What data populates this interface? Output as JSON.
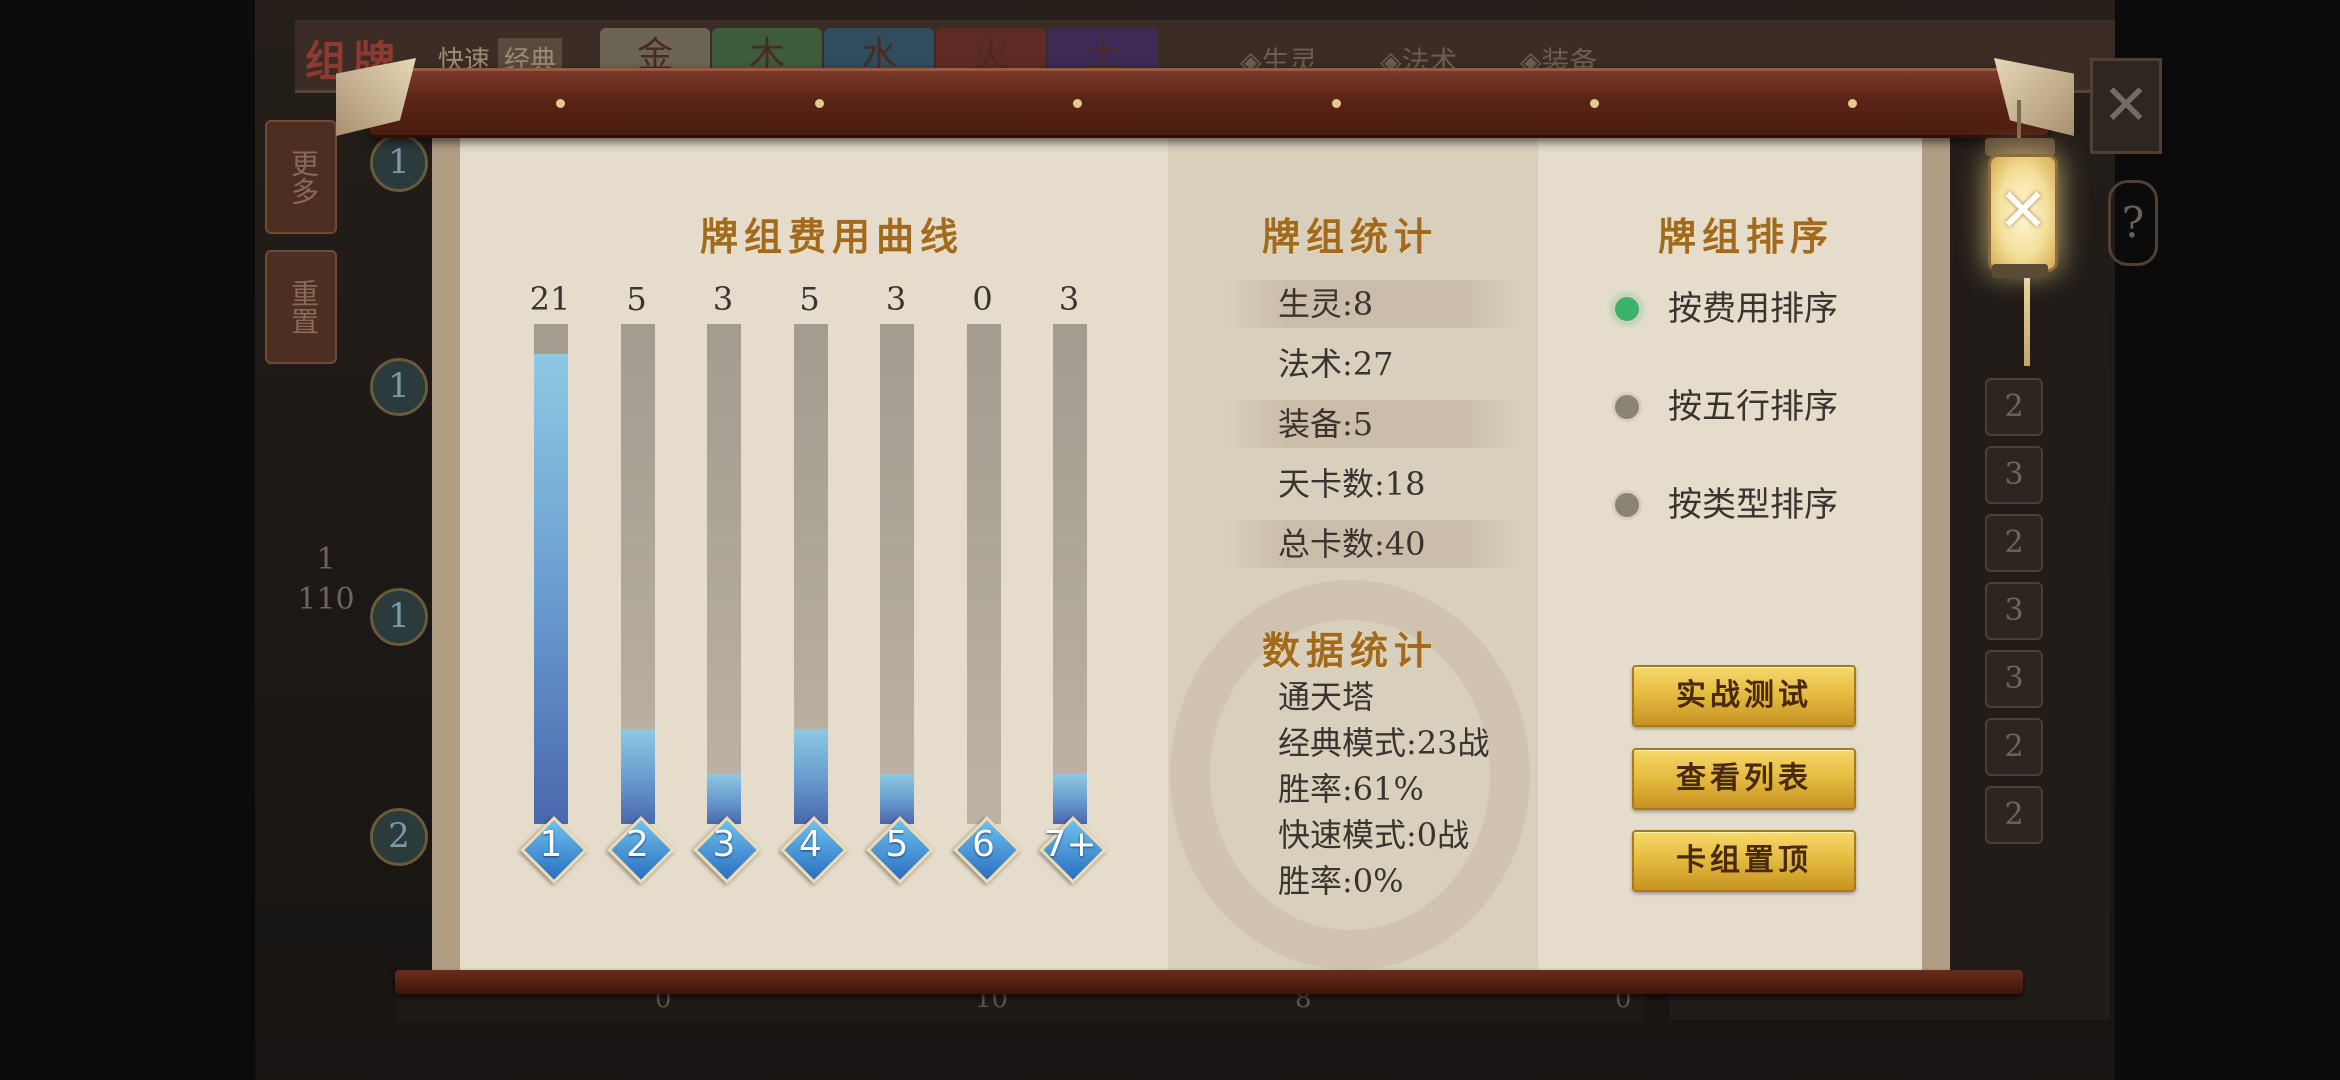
{
  "background": {
    "title": "组牌",
    "modes": [
      "快速",
      "经典"
    ],
    "elements": [
      "金",
      "木",
      "水",
      "火",
      "土"
    ],
    "filters": [
      "◈生灵",
      "◈法术",
      "◈装备"
    ],
    "side_buttons": [
      "更多",
      "重置"
    ],
    "page_current": "1",
    "page_total": "110",
    "left_costs": [
      "1",
      "1",
      "1",
      "2"
    ],
    "right_costs": [
      "2",
      "3",
      "2",
      "3",
      "3",
      "2",
      "2"
    ],
    "bottom_counts": [
      "0",
      "10",
      "8",
      "0"
    ],
    "close_glyph": "✕",
    "help_glyph": "?"
  },
  "cost_curve": {
    "title": "牌组费用曲线",
    "columns": [
      {
        "label": "1",
        "count": "21",
        "fill_fraction": 0.94
      },
      {
        "label": "2",
        "count": "5",
        "fill_fraction": 0.19
      },
      {
        "label": "3",
        "count": "3",
        "fill_fraction": 0.1
      },
      {
        "label": "4",
        "count": "5",
        "fill_fraction": 0.19
      },
      {
        "label": "5",
        "count": "3",
        "fill_fraction": 0.1
      },
      {
        "label": "6",
        "count": "0",
        "fill_fraction": 0.0
      },
      {
        "label": "7+",
        "count": "3",
        "fill_fraction": 0.1
      }
    ]
  },
  "deck_stats": {
    "title": "牌组统计",
    "rows": [
      "生灵:8",
      "法术:27",
      "装备:5",
      "天卡数:18",
      "总卡数:40"
    ]
  },
  "data_stats": {
    "title": "数据统计",
    "lines": [
      "通天塔",
      "经典模式:23战",
      "胜率:61%",
      "快速模式:0战",
      "胜率:0%"
    ]
  },
  "sort": {
    "title": "牌组排序",
    "options": [
      {
        "label": "按费用排序",
        "selected": true
      },
      {
        "label": "按五行排序",
        "selected": false
      },
      {
        "label": "按类型排序",
        "selected": false
      }
    ]
  },
  "buttons": {
    "battle_test": "实战测试",
    "view_list": "查看列表",
    "pin_deck": "卡组置顶"
  },
  "close_glyph": "✕",
  "colors": {
    "bar_fill": "#6a9ed0",
    "title_gold": "#a26a1c",
    "radio_on": "#39b36c",
    "button_gold": "#e3b93e"
  }
}
